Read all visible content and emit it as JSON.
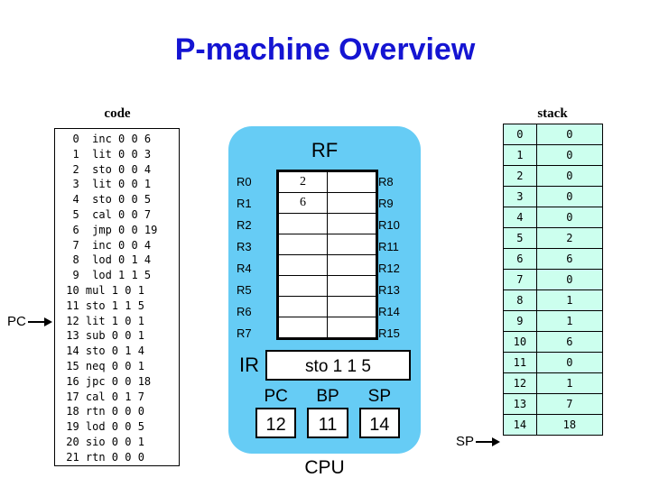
{
  "title": "P-machine Overview",
  "code": {
    "caption": "code",
    "lines": [
      "  0  inc 0 0 6",
      "  1  lit 0 0 3",
      "  2  sto 0 0 4",
      "  3  lit 0 0 1",
      "  4  sto 0 0 5",
      "  5  cal 0 0 7",
      "  6  jmp 0 0 19",
      "  7  inc 0 0 4",
      "  8  lod 0 1 4",
      "  9  lod 1 1 5",
      " 10 mul 1 0 1",
      " 11 sto 1 1 5",
      " 12 lit 1 0 1",
      " 13 sub 0 0 1",
      " 14 sto 0 1 4",
      " 15 neq 0 0 1",
      " 16 jpc 0 0 18",
      " 17 cal 0 1 7",
      " 18 rtn 0 0 0",
      " 19 lod 0 0 5",
      " 20 sio 0 0 1",
      " 21 rtn 0 0 0"
    ]
  },
  "pc_pointer": {
    "label": "PC",
    "target_line": "12"
  },
  "cpu": {
    "caption": "CPU",
    "rf": {
      "title": "RF",
      "left_labels": [
        "R0",
        "R1",
        "R2",
        "R3",
        "R4",
        "R5",
        "R6",
        "R7"
      ],
      "right_labels": [
        "R8",
        "R9",
        "R10",
        "R11",
        "R12",
        "R13",
        "R14",
        "R15"
      ],
      "left_values": [
        "2",
        "6",
        "",
        "",
        "",
        "",
        "",
        ""
      ],
      "right_values": [
        "",
        "",
        "",
        "",
        "",
        "",
        "",
        ""
      ]
    },
    "ir": {
      "label": "IR",
      "value": "sto 1 1 5"
    },
    "registers": [
      {
        "name": "PC",
        "value": "12"
      },
      {
        "name": "BP",
        "value": "11"
      },
      {
        "name": "SP",
        "value": "14"
      }
    ]
  },
  "stack": {
    "caption": "stack",
    "rows": [
      {
        "addr": "0",
        "value": "0"
      },
      {
        "addr": "1",
        "value": "0"
      },
      {
        "addr": "2",
        "value": "0"
      },
      {
        "addr": "3",
        "value": "0"
      },
      {
        "addr": "4",
        "value": "0"
      },
      {
        "addr": "5",
        "value": "2"
      },
      {
        "addr": "6",
        "value": "6"
      },
      {
        "addr": "7",
        "value": "0"
      },
      {
        "addr": "8",
        "value": "1"
      },
      {
        "addr": "9",
        "value": "1"
      },
      {
        "addr": "10",
        "value": "6"
      },
      {
        "addr": "11",
        "value": "0"
      },
      {
        "addr": "12",
        "value": "1"
      },
      {
        "addr": "13",
        "value": "7"
      },
      {
        "addr": "14",
        "value": "18"
      }
    ]
  },
  "sp_pointer": {
    "label": "SP",
    "target_addr": "14"
  },
  "colors": {
    "title": "#1414d2",
    "cpu_background": "#66ccf5",
    "stack_cell": "#ccffee",
    "cell_white": "#ffffff",
    "outline": "#000000"
  }
}
